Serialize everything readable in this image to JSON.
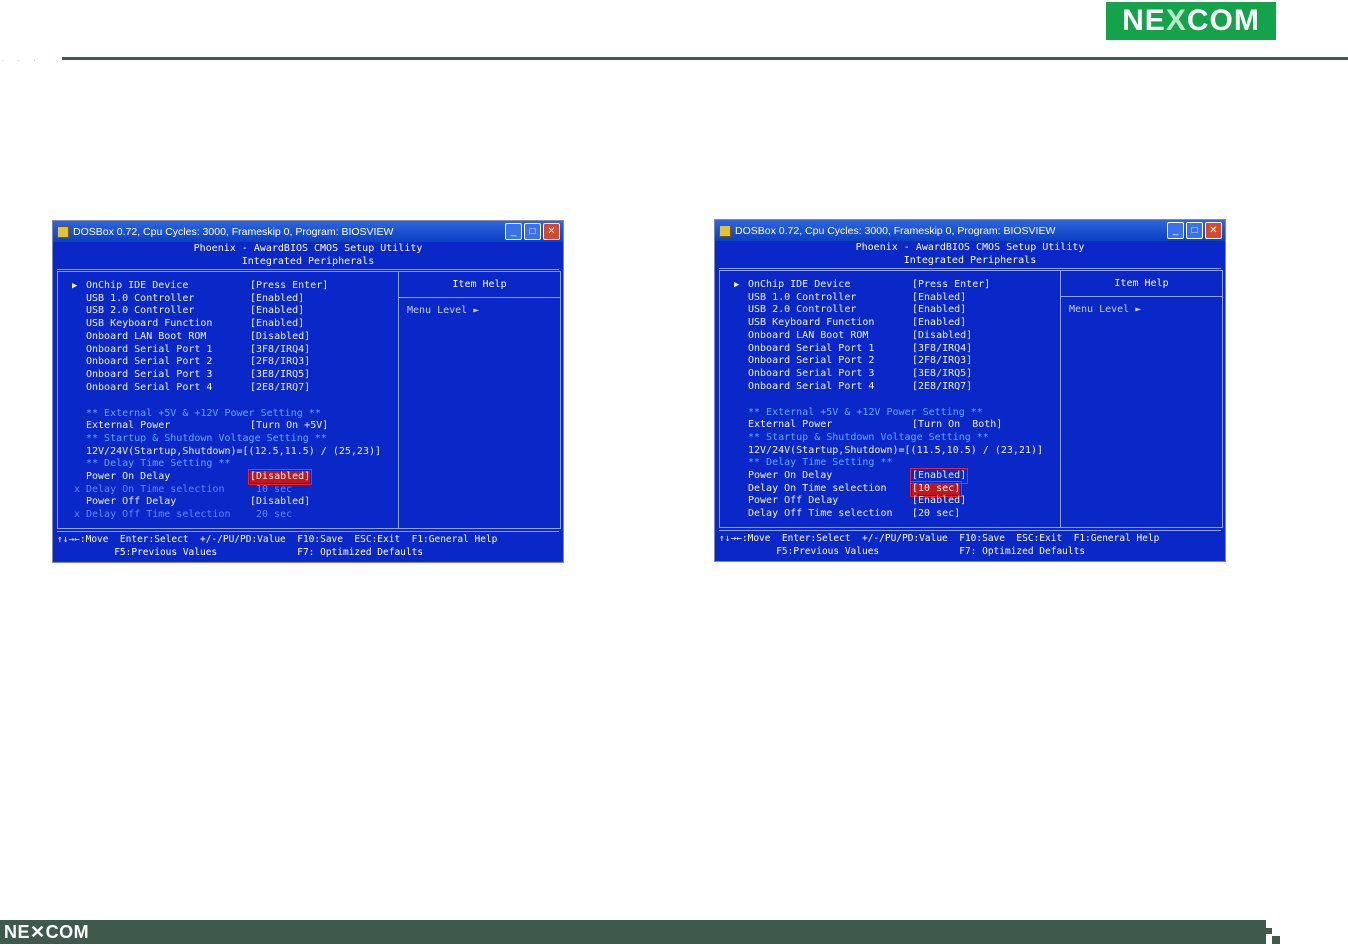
{
  "brand": {
    "logo_text_pre": "NE",
    "logo_text_x": "X",
    "logo_text_post": "COM",
    "footer_logo": "NE✕COM",
    "brand_color": "#14a34a"
  },
  "screens": [
    {
      "titlebar": "DOSBox 0.72, Cpu Cycles:     3000, Frameskip  0, Program: BIOSVIEW",
      "header_line1": "Phoenix - AwardBIOS CMOS Setup Utility",
      "header_line2": "Integrated Peripherals",
      "items": [
        {
          "label": "OnChip IDE Device",
          "value": "[Press Enter]"
        },
        {
          "label": "USB 1.0 Controller",
          "value": "[Enabled]"
        },
        {
          "label": "USB 2.0 Controller",
          "value": "[Enabled]"
        },
        {
          "label": "USB Keyboard Function",
          "value": "[Enabled]"
        },
        {
          "label": "Onboard LAN Boot ROM",
          "value": "[Disabled]"
        },
        {
          "label": "Onboard Serial Port 1",
          "value": "[3F8/IRQ4]"
        },
        {
          "label": "Onboard Serial Port 2",
          "value": "[2F8/IRQ3]"
        },
        {
          "label": "Onboard Serial Port 3",
          "value": "[3E8/IRQ5]"
        },
        {
          "label": "Onboard Serial Port 4",
          "value": "[2E8/IRQ7]"
        }
      ],
      "power_section": "** External +5V & +12V Power Setting **",
      "external_power": {
        "label": "External Power",
        "value": "[Turn On +5V]"
      },
      "voltage_section": "** Startup & Shutdown Voltage Setting **",
      "voltage_line": "12V/24V(Startup,Shutdown)=[(12.5,11.5) / (25,23)]",
      "delay_section": "** Delay Time Setting **",
      "power_on_delay": {
        "label": "Power On Delay",
        "value": "[Disabled]"
      },
      "delay_on_time": {
        "mark": "x",
        "label": "Delay On Time selection",
        "value": "10 sec"
      },
      "power_off_delay": {
        "label": "Power Off Delay",
        "value": "[Disabled]"
      },
      "delay_off_time": {
        "mark": "x",
        "label": "Delay Off Time selection",
        "value": "20 sec"
      },
      "help_title": "Item Help",
      "help_level": "Menu Level   ►",
      "footer_line1": "↑↓→←:Move  Enter:Select  +/-/PU/PD:Value  F10:Save  ESC:Exit  F1:General Help",
      "footer_line2": "          F5:Previous Values              F7: Optimized Defaults"
    },
    {
      "titlebar": "DOSBox 0.72, Cpu Cycles:     3000, Frameskip  0, Program: BIOSVIEW",
      "header_line1": "Phoenix - AwardBIOS CMOS Setup Utility",
      "header_line2": "Integrated Peripherals",
      "items": [
        {
          "label": "OnChip IDE Device",
          "value": "[Press Enter]"
        },
        {
          "label": "USB 1.0 Controller",
          "value": "[Enabled]"
        },
        {
          "label": "USB 2.0 Controller",
          "value": "[Enabled]"
        },
        {
          "label": "USB Keyboard Function",
          "value": "[Enabled]"
        },
        {
          "label": "Onboard LAN Boot ROM",
          "value": "[Disabled]"
        },
        {
          "label": "Onboard Serial Port 1",
          "value": "[3F8/IRQ4]"
        },
        {
          "label": "Onboard Serial Port 2",
          "value": "[2F8/IRQ3]"
        },
        {
          "label": "Onboard Serial Port 3",
          "value": "[3E8/IRQ5]"
        },
        {
          "label": "Onboard Serial Port 4",
          "value": "[2E8/IRQ7]"
        }
      ],
      "power_section": "** External +5V & +12V Power Setting **",
      "external_power": {
        "label": "External Power",
        "value": "[Turn On  Both]"
      },
      "voltage_section": "** Startup & Shutdown Voltage Setting **",
      "voltage_line": "12V/24V(Startup,Shutdown)=[(11.5,10.5) / (23,21)]",
      "delay_section": "** Delay Time Setting **",
      "power_on_delay": {
        "label": "Power On Delay",
        "value": "[Enabled]"
      },
      "delay_on_time": {
        "mark": "",
        "label": "Delay On Time selection",
        "value": "[10 sec]"
      },
      "power_off_delay": {
        "label": "Power Off Delay",
        "value": "[Enabled]"
      },
      "delay_off_time": {
        "mark": "",
        "label": "Delay Off Time selection",
        "value": "[20 sec]"
      },
      "help_title": "Item Help",
      "help_level": "Menu Level   ►",
      "footer_line1": "↑↓→←:Move  Enter:Select  +/-/PU/PD:Value  F10:Save  ESC:Exit  F1:General Help",
      "footer_line2": "          F5:Previous Values              F7: Optimized Defaults"
    }
  ]
}
